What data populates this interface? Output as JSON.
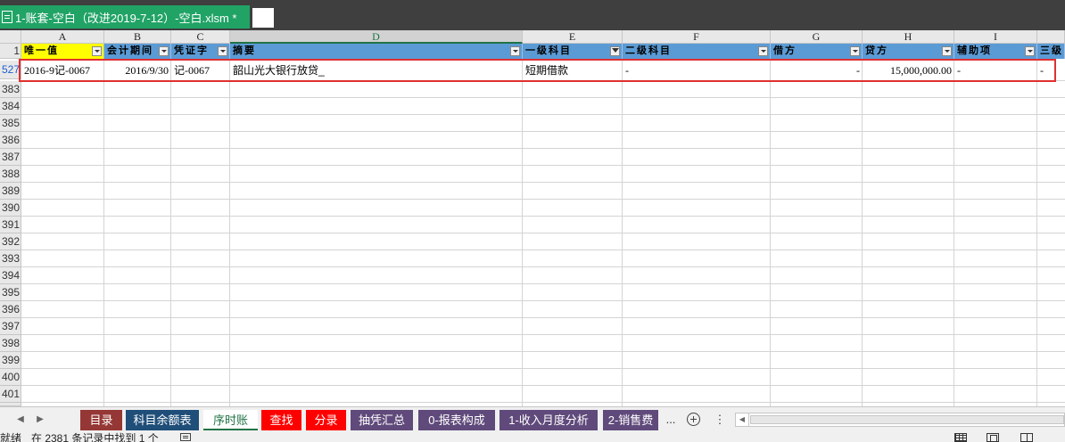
{
  "window": {
    "doc_tab_title": "1-账套-空白（改进2019-7-12）-空白.xlsm *"
  },
  "columns": [
    {
      "letter": "A",
      "selected": false
    },
    {
      "letter": "B",
      "selected": false
    },
    {
      "letter": "C",
      "selected": false
    },
    {
      "letter": "D",
      "selected": true
    },
    {
      "letter": "E",
      "selected": false
    },
    {
      "letter": "F",
      "selected": false
    },
    {
      "letter": "G",
      "selected": false
    },
    {
      "letter": "H",
      "selected": false
    },
    {
      "letter": "I",
      "selected": false
    },
    {
      "letter": "",
      "selected": false
    }
  ],
  "header_row": {
    "row_number": "1",
    "cells": [
      {
        "label": "唯一值",
        "filtered": false
      },
      {
        "label": "会计期间",
        "filtered": false
      },
      {
        "label": "凭证字",
        "filtered": false
      },
      {
        "label": "摘要",
        "filtered": false
      },
      {
        "label": "一级科目",
        "filtered": true
      },
      {
        "label": "二级科目",
        "filtered": false
      },
      {
        "label": "借方",
        "filtered": false
      },
      {
        "label": "贷方",
        "filtered": false
      },
      {
        "label": "辅助项",
        "filtered": false
      },
      {
        "label": "三级",
        "filtered": false
      }
    ]
  },
  "filtered_row": {
    "row_number": "527",
    "cells": [
      "2016-9记-0067",
      "2016/9/30",
      "记-0067",
      "韶山光大银行放贷_",
      "短期借款",
      "-",
      "-",
      "15,000,000.00",
      "-",
      "-"
    ]
  },
  "empty_rows": [
    "383",
    "384",
    "385",
    "386",
    "387",
    "388",
    "389",
    "390",
    "391",
    "392",
    "393",
    "394",
    "395",
    "396",
    "397",
    "398",
    "399",
    "400",
    "401"
  ],
  "sheet_tabs": [
    {
      "label": "目录",
      "color": "#953735",
      "active": false
    },
    {
      "label": "科目余额表",
      "color": "#1f4e79",
      "active": false
    },
    {
      "label": "序时账",
      "color": "#ffffff",
      "active": true
    },
    {
      "label": "查找",
      "color": "#ff0000",
      "active": false
    },
    {
      "label": "分录",
      "color": "#ff0000",
      "active": false
    },
    {
      "label": "抽凭汇总",
      "color": "#604a7b",
      "active": false
    },
    {
      "label": "0-报表构成",
      "color": "#604a7b",
      "active": false
    },
    {
      "label": "1-收入月度分析",
      "color": "#604a7b",
      "active": false
    },
    {
      "label": "2-销售费",
      "color": "#604a7b",
      "active": false
    }
  ],
  "sheet_nav": {
    "ellipsis": "...",
    "menu": "⋮"
  },
  "status": {
    "ready": "就绪",
    "find_result": "在 2381 条记录中找到 1 个"
  },
  "colors": {
    "excel_green": "#21a366",
    "header_blue": "#5b9bd5",
    "header_yellow": "#ffff00",
    "highlight_red": "#e03030"
  }
}
